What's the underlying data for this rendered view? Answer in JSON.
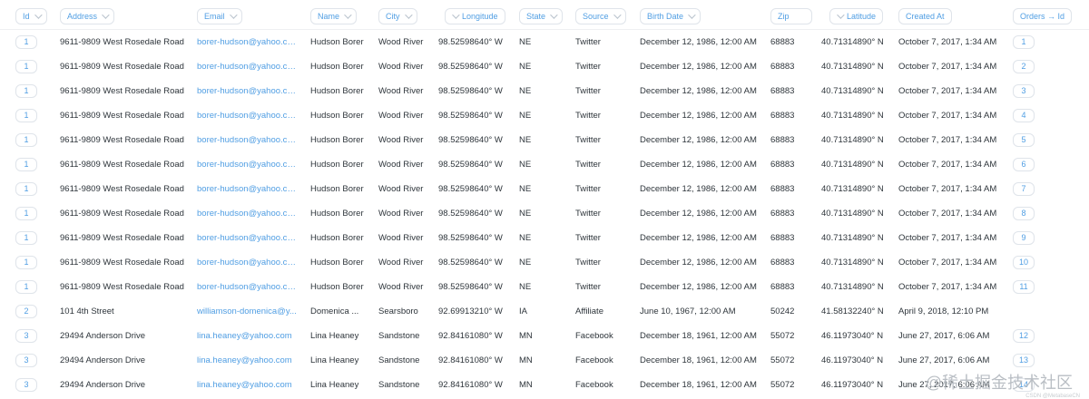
{
  "headers": {
    "id": "Id",
    "address": "Address",
    "email": "Email",
    "name": "Name",
    "city": "City",
    "longitude": "Longitude",
    "state": "State",
    "source": "Source",
    "birth_date": "Birth Date",
    "zip": "Zip",
    "latitude": "Latitude",
    "created_at": "Created At",
    "orders_id": "Orders → Id"
  },
  "rows": [
    {
      "id": "1",
      "address": "9611-9809 West Rosedale Road",
      "email": "borer-hudson@yahoo.com",
      "name": "Hudson Borer",
      "city": "Wood River",
      "longitude": "98.52598640° W",
      "state": "NE",
      "source": "Twitter",
      "birth_date": "December 12, 1986, 12:00 AM",
      "zip": "68883",
      "latitude": "40.71314890° N",
      "created_at": "October 7, 2017, 1:34 AM",
      "orders_id": "1"
    },
    {
      "id": "1",
      "address": "9611-9809 West Rosedale Road",
      "email": "borer-hudson@yahoo.com",
      "name": "Hudson Borer",
      "city": "Wood River",
      "longitude": "98.52598640° W",
      "state": "NE",
      "source": "Twitter",
      "birth_date": "December 12, 1986, 12:00 AM",
      "zip": "68883",
      "latitude": "40.71314890° N",
      "created_at": "October 7, 2017, 1:34 AM",
      "orders_id": "2"
    },
    {
      "id": "1",
      "address": "9611-9809 West Rosedale Road",
      "email": "borer-hudson@yahoo.com",
      "name": "Hudson Borer",
      "city": "Wood River",
      "longitude": "98.52598640° W",
      "state": "NE",
      "source": "Twitter",
      "birth_date": "December 12, 1986, 12:00 AM",
      "zip": "68883",
      "latitude": "40.71314890° N",
      "created_at": "October 7, 2017, 1:34 AM",
      "orders_id": "3"
    },
    {
      "id": "1",
      "address": "9611-9809 West Rosedale Road",
      "email": "borer-hudson@yahoo.com",
      "name": "Hudson Borer",
      "city": "Wood River",
      "longitude": "98.52598640° W",
      "state": "NE",
      "source": "Twitter",
      "birth_date": "December 12, 1986, 12:00 AM",
      "zip": "68883",
      "latitude": "40.71314890° N",
      "created_at": "October 7, 2017, 1:34 AM",
      "orders_id": "4"
    },
    {
      "id": "1",
      "address": "9611-9809 West Rosedale Road",
      "email": "borer-hudson@yahoo.com",
      "name": "Hudson Borer",
      "city": "Wood River",
      "longitude": "98.52598640° W",
      "state": "NE",
      "source": "Twitter",
      "birth_date": "December 12, 1986, 12:00 AM",
      "zip": "68883",
      "latitude": "40.71314890° N",
      "created_at": "October 7, 2017, 1:34 AM",
      "orders_id": "5"
    },
    {
      "id": "1",
      "address": "9611-9809 West Rosedale Road",
      "email": "borer-hudson@yahoo.com",
      "name": "Hudson Borer",
      "city": "Wood River",
      "longitude": "98.52598640° W",
      "state": "NE",
      "source": "Twitter",
      "birth_date": "December 12, 1986, 12:00 AM",
      "zip": "68883",
      "latitude": "40.71314890° N",
      "created_at": "October 7, 2017, 1:34 AM",
      "orders_id": "6"
    },
    {
      "id": "1",
      "address": "9611-9809 West Rosedale Road",
      "email": "borer-hudson@yahoo.com",
      "name": "Hudson Borer",
      "city": "Wood River",
      "longitude": "98.52598640° W",
      "state": "NE",
      "source": "Twitter",
      "birth_date": "December 12, 1986, 12:00 AM",
      "zip": "68883",
      "latitude": "40.71314890° N",
      "created_at": "October 7, 2017, 1:34 AM",
      "orders_id": "7"
    },
    {
      "id": "1",
      "address": "9611-9809 West Rosedale Road",
      "email": "borer-hudson@yahoo.com",
      "name": "Hudson Borer",
      "city": "Wood River",
      "longitude": "98.52598640° W",
      "state": "NE",
      "source": "Twitter",
      "birth_date": "December 12, 1986, 12:00 AM",
      "zip": "68883",
      "latitude": "40.71314890° N",
      "created_at": "October 7, 2017, 1:34 AM",
      "orders_id": "8"
    },
    {
      "id": "1",
      "address": "9611-9809 West Rosedale Road",
      "email": "borer-hudson@yahoo.com",
      "name": "Hudson Borer",
      "city": "Wood River",
      "longitude": "98.52598640° W",
      "state": "NE",
      "source": "Twitter",
      "birth_date": "December 12, 1986, 12:00 AM",
      "zip": "68883",
      "latitude": "40.71314890° N",
      "created_at": "October 7, 2017, 1:34 AM",
      "orders_id": "9"
    },
    {
      "id": "1",
      "address": "9611-9809 West Rosedale Road",
      "email": "borer-hudson@yahoo.com",
      "name": "Hudson Borer",
      "city": "Wood River",
      "longitude": "98.52598640° W",
      "state": "NE",
      "source": "Twitter",
      "birth_date": "December 12, 1986, 12:00 AM",
      "zip": "68883",
      "latitude": "40.71314890° N",
      "created_at": "October 7, 2017, 1:34 AM",
      "orders_id": "10"
    },
    {
      "id": "1",
      "address": "9611-9809 West Rosedale Road",
      "email": "borer-hudson@yahoo.com",
      "name": "Hudson Borer",
      "city": "Wood River",
      "longitude": "98.52598640° W",
      "state": "NE",
      "source": "Twitter",
      "birth_date": "December 12, 1986, 12:00 AM",
      "zip": "68883",
      "latitude": "40.71314890° N",
      "created_at": "October 7, 2017, 1:34 AM",
      "orders_id": "11"
    },
    {
      "id": "2",
      "address": "101 4th Street",
      "email": "williamson-domenica@y...",
      "name": "Domenica ...",
      "city": "Searsboro",
      "longitude": "92.69913210° W",
      "state": "IA",
      "source": "Affiliate",
      "birth_date": "June 10, 1967, 12:00 AM",
      "zip": "50242",
      "latitude": "41.58132240° N",
      "created_at": "April 9, 2018, 12:10 PM",
      "orders_id": ""
    },
    {
      "id": "3",
      "address": "29494 Anderson Drive",
      "email": "lina.heaney@yahoo.com",
      "name": "Lina Heaney",
      "city": "Sandstone",
      "longitude": "92.84161080° W",
      "state": "MN",
      "source": "Facebook",
      "birth_date": "December 18, 1961, 12:00 AM",
      "zip": "55072",
      "latitude": "46.11973040° N",
      "created_at": "June 27, 2017, 6:06 AM",
      "orders_id": "12"
    },
    {
      "id": "3",
      "address": "29494 Anderson Drive",
      "email": "lina.heaney@yahoo.com",
      "name": "Lina Heaney",
      "city": "Sandstone",
      "longitude": "92.84161080° W",
      "state": "MN",
      "source": "Facebook",
      "birth_date": "December 18, 1961, 12:00 AM",
      "zip": "55072",
      "latitude": "46.11973040° N",
      "created_at": "June 27, 2017, 6:06 AM",
      "orders_id": "13"
    },
    {
      "id": "3",
      "address": "29494 Anderson Drive",
      "email": "lina.heaney@yahoo.com",
      "name": "Lina Heaney",
      "city": "Sandstone",
      "longitude": "92.84161080° W",
      "state": "MN",
      "source": "Facebook",
      "birth_date": "December 18, 1961, 12:00 AM",
      "zip": "55072",
      "latitude": "46.11973040° N",
      "created_at": "June 27, 2017, 6:06 AM",
      "orders_id": "14"
    }
  ],
  "watermark": "@稀土掘金技术社区",
  "credit": "CSDN @MetabaseCN",
  "colors": {
    "link": "#509ee3",
    "text": "#2e353b",
    "border": "#dfe4ea"
  }
}
